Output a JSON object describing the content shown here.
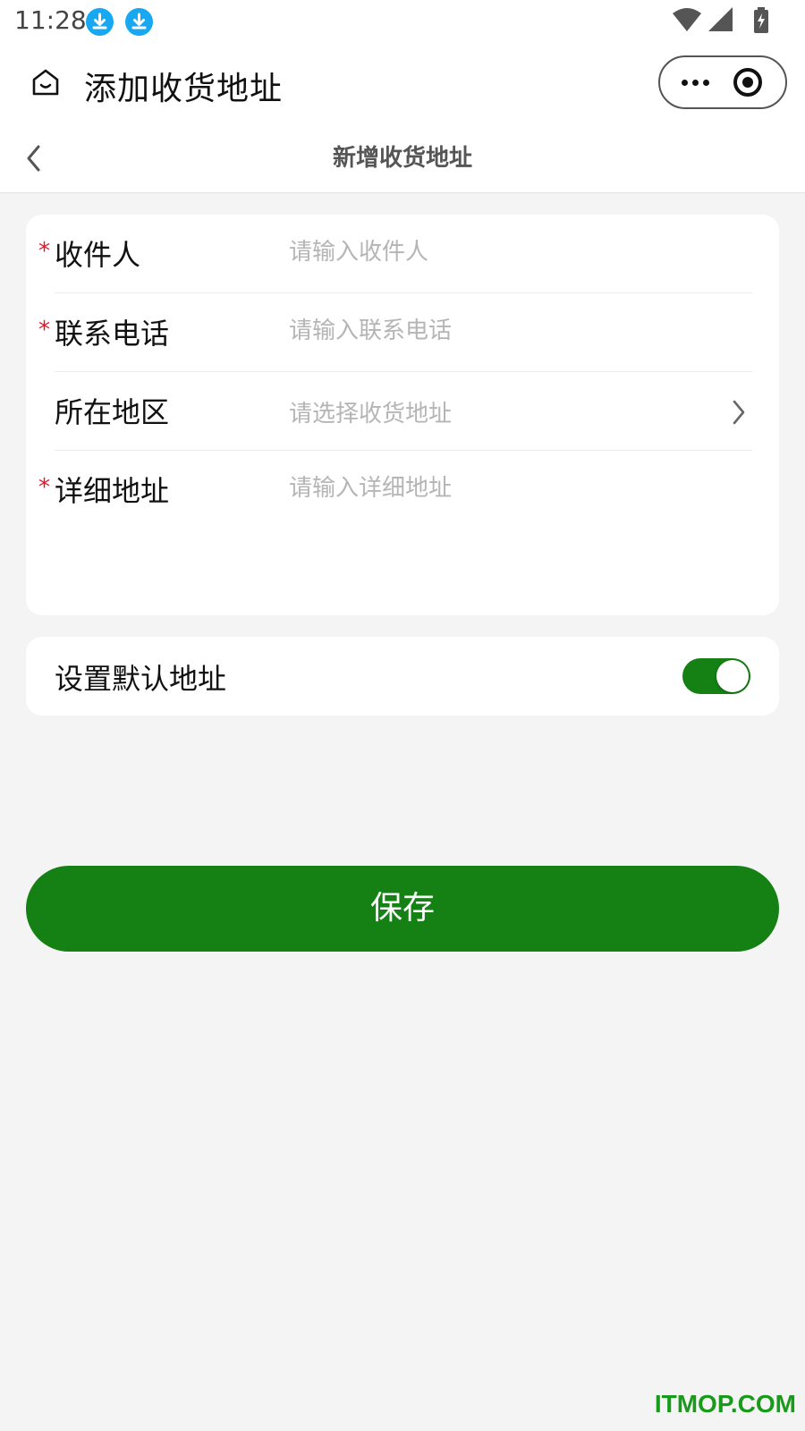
{
  "status_bar": {
    "time": "11:28",
    "icons": [
      "download-notification-icon",
      "download-notification-icon",
      "wifi-icon",
      "signal-icon",
      "battery-charging-icon"
    ]
  },
  "mp_header": {
    "title": "添加收货地址",
    "home_icon": "home-icon",
    "more_icon": "more-dots-icon",
    "close_icon": "close-target-icon"
  },
  "page_nav": {
    "back_icon": "back-chevron-icon",
    "title": "新增收货地址"
  },
  "form": {
    "fields": [
      {
        "label": "收件人",
        "required": "*",
        "placeholder": "请输入收件人",
        "value": ""
      },
      {
        "label": "联系电话",
        "required": "*",
        "placeholder": "请输入联系电话",
        "value": ""
      },
      {
        "label": "所在地区",
        "required": "",
        "placeholder": "请选择收货地址",
        "value": ""
      },
      {
        "label": "详细地址",
        "required": "*",
        "placeholder": "请输入详细地址",
        "value": ""
      }
    ]
  },
  "default_address": {
    "label": "设置默认地址",
    "enabled": true
  },
  "save_label": "保存",
  "watermark": "ITMOP.COM",
  "colors": {
    "accent": "#158115",
    "required": "#e0182a",
    "placeholder": "#b5b5b5",
    "page_bg": "#f4f4f4",
    "download_badge": "#17a8f1"
  }
}
